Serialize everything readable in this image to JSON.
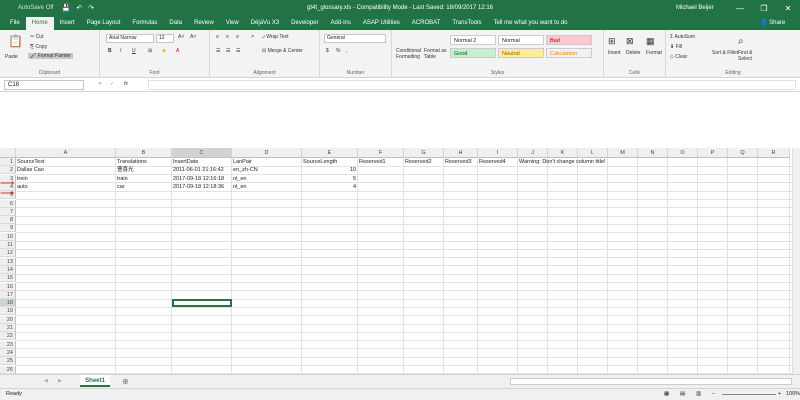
{
  "titlebar": {
    "autosave": "AutoSave",
    "autosave_state": "Off",
    "title": "gt4t_glossary.xls - Compatibility Mode - Last Saved: 18/09/2017 12:16",
    "user": "Michael Beijer",
    "minimize": "—",
    "restore": "❐",
    "close": "✕"
  },
  "tabs": [
    "File",
    "Home",
    "Insert",
    "Page Layout",
    "Formulas",
    "Data",
    "Review",
    "View",
    "DéjàVu X3",
    "Developer",
    "Add-ins",
    "ASAP Utilities",
    "ACROBAT",
    "TransTools",
    "Tell me what you want to do"
  ],
  "active_tab": "Home",
  "share": "Share",
  "ribbon": {
    "clipboard": {
      "paste": "Paste",
      "cut": "Cut",
      "copy": "Copy",
      "format_painter": "Format Painter",
      "label": "Clipboard"
    },
    "font": {
      "name": "Arial Narrow",
      "size": "12",
      "bold": "B",
      "italic": "I",
      "underline": "U",
      "label": "Font"
    },
    "alignment": {
      "wrap": "Wrap Text",
      "merge": "Merge & Center",
      "label": "Alignment"
    },
    "number": {
      "format": "General",
      "label": "Number"
    },
    "styles": {
      "conditional": "Conditional Formatting",
      "format_table": "Format as Table",
      "normal2": "Normal 2",
      "normal": "Normal",
      "bad": "Bad",
      "good": "Good",
      "neutral": "Neutral",
      "calculation": "Calculation",
      "label": "Styles"
    },
    "cells": {
      "insert": "Insert",
      "delete": "Delete",
      "format": "Format",
      "label": "Cells"
    },
    "editing": {
      "autosum": "AutoSum",
      "fill": "Fill",
      "clear": "Clear",
      "sort": "Sort & Filter",
      "find": "Find & Select",
      "label": "Editing"
    }
  },
  "formula_bar": {
    "name_box": "C18",
    "fx": "fx",
    "value": ""
  },
  "columns": [
    "A",
    "B",
    "C",
    "D",
    "E",
    "F",
    "G",
    "H",
    "I",
    "J",
    "K",
    "L",
    "M",
    "N",
    "O",
    "P",
    "Q",
    "R"
  ],
  "rows": [
    [
      "SourceText",
      "Translations",
      "InsertDate",
      "LanPair",
      "SourceLength",
      "Reserved1",
      "Reserved2",
      "Reserved3",
      "Reserved4",
      "Warning: Don't change column title!"
    ],
    [
      "Dallas Cao",
      "曹喜光",
      "2011-06-01 21:16:42",
      "en_zh-CN",
      "10"
    ],
    [
      "trein",
      "train",
      "2017-09-18 12:16:18",
      "nl_en",
      "5"
    ],
    [
      "auto",
      "car",
      "2017-09-18 12:18:36",
      "nl_en",
      "4"
    ]
  ],
  "row_numbers": [
    "1",
    "2",
    "3",
    "4",
    "5",
    "6",
    "7",
    "8",
    "9",
    "10",
    "11",
    "12",
    "13",
    "14",
    "15",
    "16",
    "17",
    "18",
    "19",
    "20",
    "21",
    "22",
    "23",
    "24",
    "25",
    "26"
  ],
  "sheet_tab": "Sheet1",
  "status": {
    "ready": "Ready",
    "zoom": "100%"
  },
  "colors": {
    "accent": "#217346",
    "arrow": "#c0392b"
  }
}
